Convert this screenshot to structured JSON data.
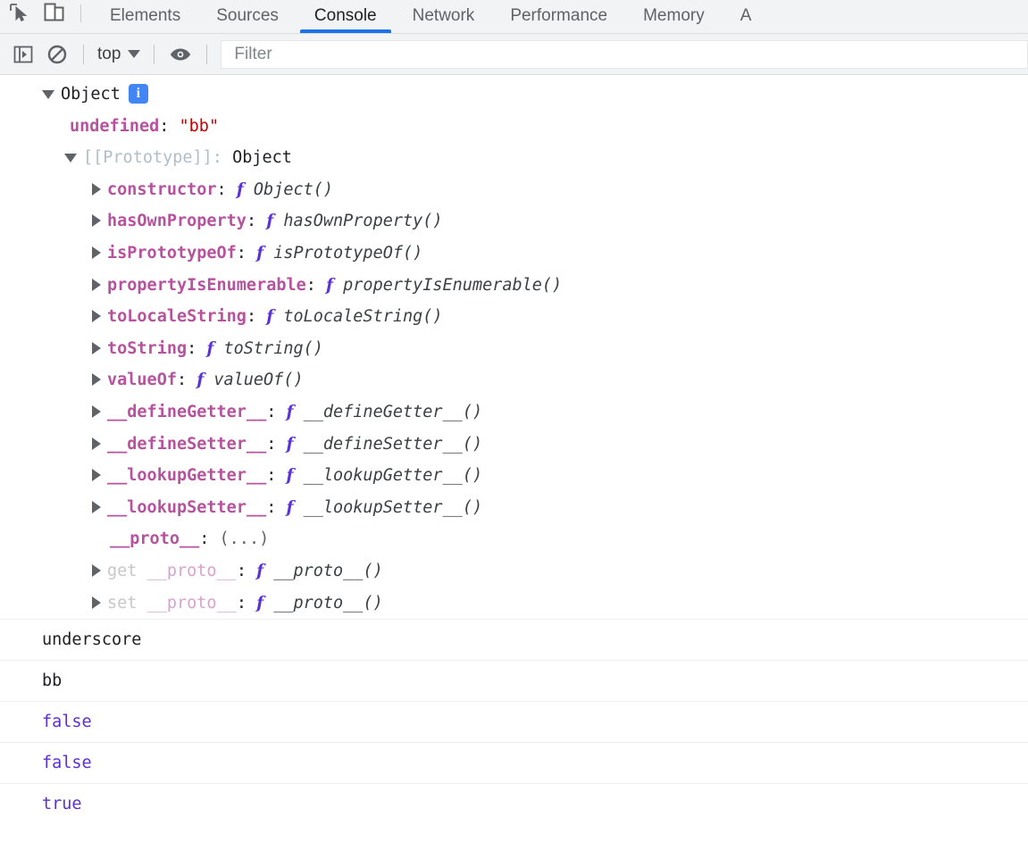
{
  "devtools": {
    "icons": {
      "inspect": "inspect-element-icon",
      "device": "device-toolbar-icon"
    },
    "tabs": [
      {
        "label": "Elements",
        "active": false
      },
      {
        "label": "Sources",
        "active": false
      },
      {
        "label": "Console",
        "active": true
      },
      {
        "label": "Network",
        "active": false
      },
      {
        "label": "Performance",
        "active": false
      },
      {
        "label": "Memory",
        "active": false
      },
      {
        "label": "A",
        "active": false
      }
    ],
    "accent_color": "#1a73e8"
  },
  "toolbar": {
    "sidebar_toggle_icon": "console-sidebar-icon",
    "clear_console_icon": "clear-console-icon",
    "context_selector": "top",
    "eye_icon": "live-expression-eye-icon",
    "filter_placeholder": "Filter"
  },
  "console": {
    "object_tree": {
      "root_label": "Object",
      "root_badge": "i",
      "own_property": {
        "key": "undefined",
        "colon": ":",
        "value": "\"bb\""
      },
      "prototype_label": "[[Prototype]]",
      "prototype_value": "Object",
      "members": [
        {
          "key": "constructor",
          "fn": "f",
          "value": "Object()"
        },
        {
          "key": "hasOwnProperty",
          "fn": "f",
          "value": "hasOwnProperty()"
        },
        {
          "key": "isPrototypeOf",
          "fn": "f",
          "value": "isPrototypeOf()"
        },
        {
          "key": "propertyIsEnumerable",
          "fn": "f",
          "value": "propertyIsEnumerable()"
        },
        {
          "key": "toLocaleString",
          "fn": "f",
          "value": "toLocaleString()"
        },
        {
          "key": "toString",
          "fn": "f",
          "value": "toString()"
        },
        {
          "key": "valueOf",
          "fn": "f",
          "value": "valueOf()"
        },
        {
          "key": "__defineGetter__",
          "fn": "f",
          "value": "__defineGetter__()"
        },
        {
          "key": "__defineSetter__",
          "fn": "f",
          "value": "__defineSetter__()"
        },
        {
          "key": "__lookupGetter__",
          "fn": "f",
          "value": "__lookupGetter__()"
        },
        {
          "key": "__lookupSetter__",
          "fn": "f",
          "value": "__lookupSetter__()"
        }
      ],
      "proto_collapsed": {
        "key": "__proto__",
        "value": "(...)"
      },
      "accessors": [
        {
          "kind": "get",
          "key": "__proto__",
          "fn": "f",
          "value": "__proto__()"
        },
        {
          "kind": "set",
          "key": "__proto__",
          "fn": "f",
          "value": "__proto__()"
        }
      ]
    },
    "log_entries": [
      {
        "text": "underscore",
        "type": "string"
      },
      {
        "text": "bb",
        "type": "string"
      },
      {
        "text": "false",
        "type": "boolean"
      },
      {
        "text": "false",
        "type": "boolean"
      },
      {
        "text": "true",
        "type": "boolean"
      }
    ]
  },
  "colors": {
    "property_name": "#b7529e",
    "string_value": "#c80000",
    "boolean_value": "#5b2fd4",
    "function_keyword": "#5a32d6",
    "internal_property": "#b0bec9",
    "tab_accent": "#1a73e8",
    "badge_blue": "#4285f4"
  }
}
